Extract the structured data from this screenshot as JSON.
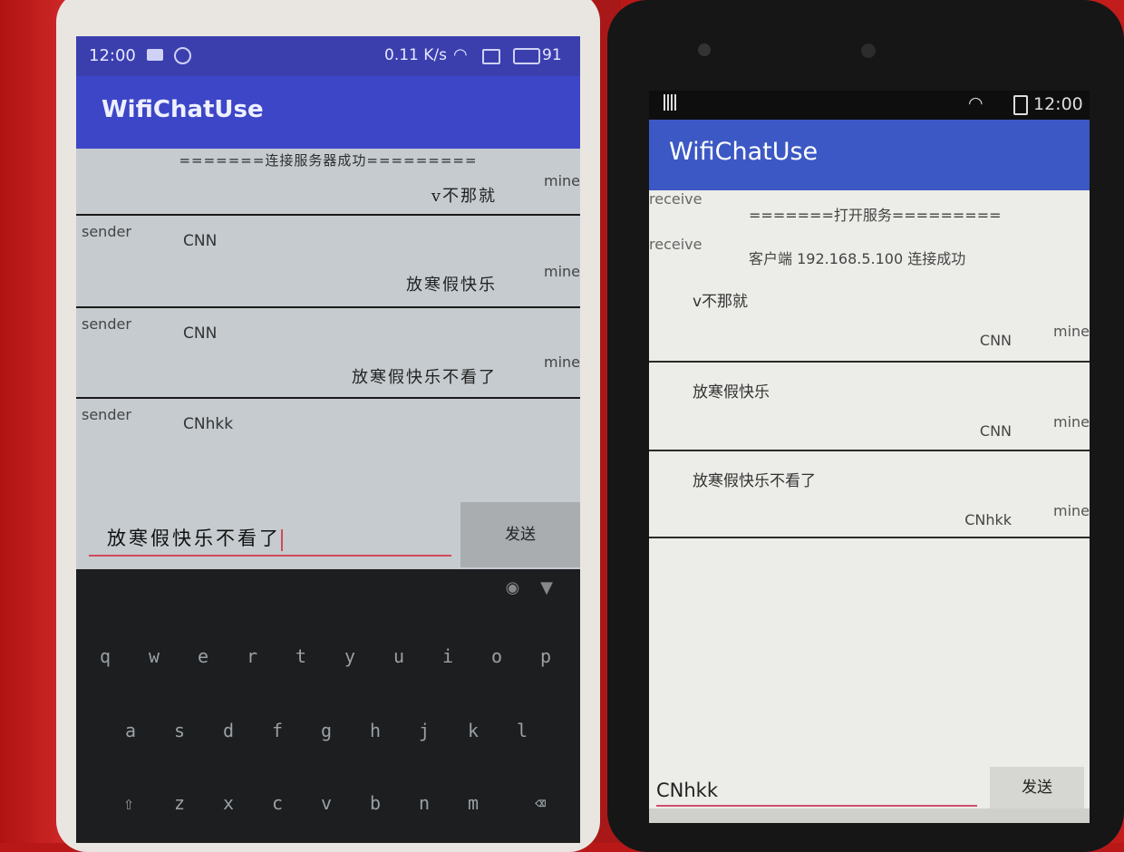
{
  "left_phone": {
    "status": {
      "time": "12:00",
      "network": "0.11 K/s",
      "battery": "91"
    },
    "app_title": "WifiChatUse",
    "messages": [
      {
        "system": "=======连接服务器成功=========",
        "text": "v不那就",
        "mine": "mine"
      },
      {
        "sender": "sender",
        "name": "CNN",
        "text": "放寒假快乐",
        "mine": "mine"
      },
      {
        "sender": "sender",
        "name": "CNN",
        "text": "放寒假快乐不看了",
        "mine": "mine"
      },
      {
        "sender": "sender",
        "name": "CNhkk"
      }
    ],
    "input_value": "放寒假快乐不看了",
    "send_label": "发送",
    "keyboard": {
      "row1": [
        "q",
        "w",
        "e",
        "r",
        "t",
        "y",
        "u",
        "i",
        "o",
        "p"
      ],
      "row2": [
        "a",
        "s",
        "d",
        "f",
        "g",
        "h",
        "j",
        "k",
        "l"
      ],
      "row3": [
        "z",
        "x",
        "c",
        "v",
        "b",
        "n",
        "m"
      ],
      "shift_icon": "shift-icon",
      "backspace_icon": "backspace-icon"
    }
  },
  "right_phone": {
    "status": {
      "time": "12:00"
    },
    "app_title": "WifiChatUse",
    "receive1": "receive",
    "system1": "=======打开服务=========",
    "receive2": "receive",
    "system2": "客户端 192.168.5.100 连接成功",
    "messages": [
      {
        "text": "v不那就",
        "name": "CNN",
        "mine": "mine"
      },
      {
        "text": "放寒假快乐",
        "name": "CNN",
        "mine": "mine"
      },
      {
        "text": "放寒假快乐不看了",
        "name": "CNhkk",
        "mine": "mine"
      }
    ],
    "input_value": "CNhkk",
    "send_label": "发送"
  }
}
